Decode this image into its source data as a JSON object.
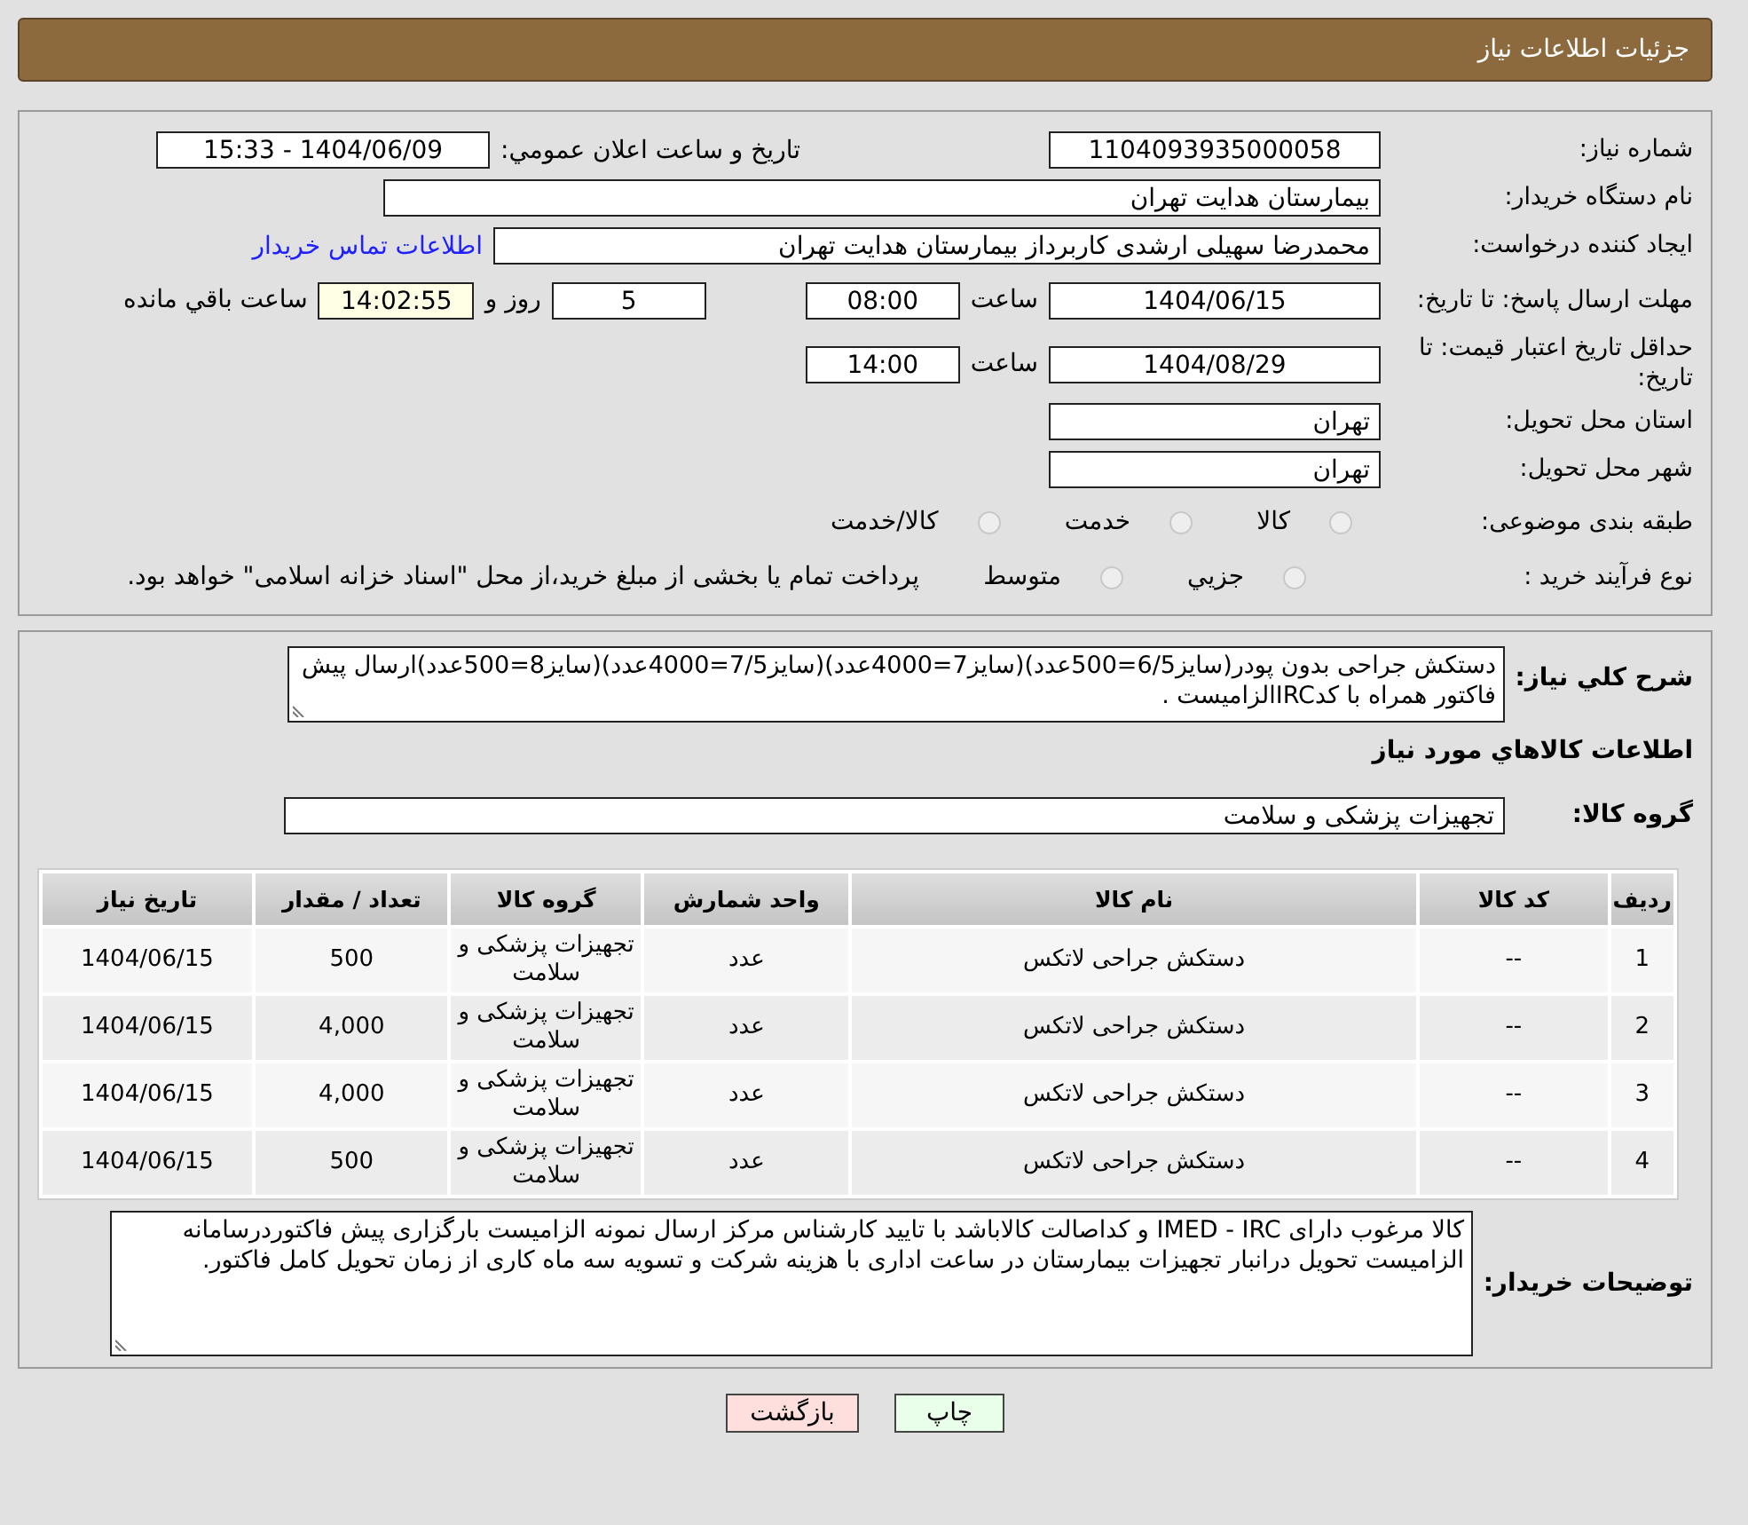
{
  "header": {
    "title": "جزئیات اطلاعات نیاز"
  },
  "details": {
    "need_number": {
      "label": "شماره نیاز:",
      "value": "1104093935000058"
    },
    "announce": {
      "label": "تاریخ و ساعت اعلان عمومي:",
      "value": "1404/06/09 - 15:33"
    },
    "buyer_org": {
      "label": "نام دستگاه خریدار:",
      "value": "بیمارستان هدایت تهران"
    },
    "requester": {
      "label": "ایجاد کننده درخواست:",
      "value": "محمدرضا سهیلی ارشدی کاربرداز بیمارستان هدایت تهران",
      "link": "اطلاعات تماس خریدار"
    },
    "reply_deadline": {
      "label": "مهلت ارسال پاسخ: تا تاریخ:",
      "date": "1404/06/15",
      "time_label": "ساعت",
      "time": "08:00",
      "days": "5",
      "days_label": "روز و",
      "remaining": "14:02:55",
      "remaining_label": "ساعت باقي مانده"
    },
    "price_validity": {
      "label": "حداقل تاریخ اعتبار قیمت: تا تاریخ:",
      "date": "1404/08/29",
      "time_label": "ساعت",
      "time": "14:00"
    },
    "province": {
      "label": "استان محل تحویل:",
      "value": "تهران"
    },
    "city": {
      "label": "شهر محل تحویل:",
      "value": "تهران"
    },
    "category": {
      "label": "طبقه بندی موضوعی:",
      "options": [
        {
          "label": "کالا",
          "selected": false
        },
        {
          "label": "خدمت",
          "selected": false
        },
        {
          "label": "کالا/خدمت",
          "selected": false
        }
      ]
    },
    "process": {
      "label": "نوع فرآیند خرید :",
      "options": [
        {
          "label": "جزيي",
          "selected": false
        },
        {
          "label": "متوسط",
          "selected": false
        }
      ],
      "note": "پرداخت تمام یا بخشی از مبلغ خرید،از محل \"اسناد خزانه اسلامی\" خواهد بود."
    }
  },
  "needs": {
    "description_label": "شرح کلي نیاز:",
    "description": "دستکش جراحی بدون پودر(سایز6/5=500عدد)(سایز7=4000عدد)(سایز7/5=4000عدد)(سایز8=500عدد)ارسال پیش فاکتور همراه با کدIRCالزامیست .",
    "goods_heading": "اطلاعات کالاهاي مورد نیاز",
    "group_label": "گروه کالا:",
    "group": "تجهیزات پزشکی و سلامت",
    "table": {
      "columns": [
        "ردیف",
        "کد کالا",
        "نام کالا",
        "واحد شمارش",
        "گروه کالا",
        "تعداد / مقدار",
        "تاریخ نیاز"
      ],
      "rows": [
        [
          "1",
          "--",
          "دستکش جراحی لاتکس",
          "عدد",
          "تجهیزات پزشکی و سلامت",
          "500",
          "1404/06/15"
        ],
        [
          "2",
          "--",
          "دستکش جراحی لاتکس",
          "عدد",
          "تجهیزات پزشکی و سلامت",
          "4,000",
          "1404/06/15"
        ],
        [
          "3",
          "--",
          "دستکش جراحی لاتکس",
          "عدد",
          "تجهیزات پزشکی و سلامت",
          "4,000",
          "1404/06/15"
        ],
        [
          "4",
          "--",
          "دستکش جراحی لاتکس",
          "عدد",
          "تجهیزات پزشکی و سلامت",
          "500",
          "1404/06/15"
        ]
      ]
    },
    "notes_label": "توضیحات خریدار:",
    "notes": "کالا مرغوب دارای IMED - IRC و کداصالت کالاباشد با تایید کارشناس مرکز ارسال نمونه الزامیست بارگزاری پیش فاکتوردرسامانه الزامیست تحویل درانبار تجهیزات بیمارستان در ساعت اداری با هزینه شرکت و تسویه سه ماه کاری از زمان تحویل کامل فاکتور."
  },
  "buttons": [
    {
      "label": "چاپ",
      "kind": "print"
    },
    {
      "label": "بازگشت",
      "kind": "back"
    }
  ]
}
